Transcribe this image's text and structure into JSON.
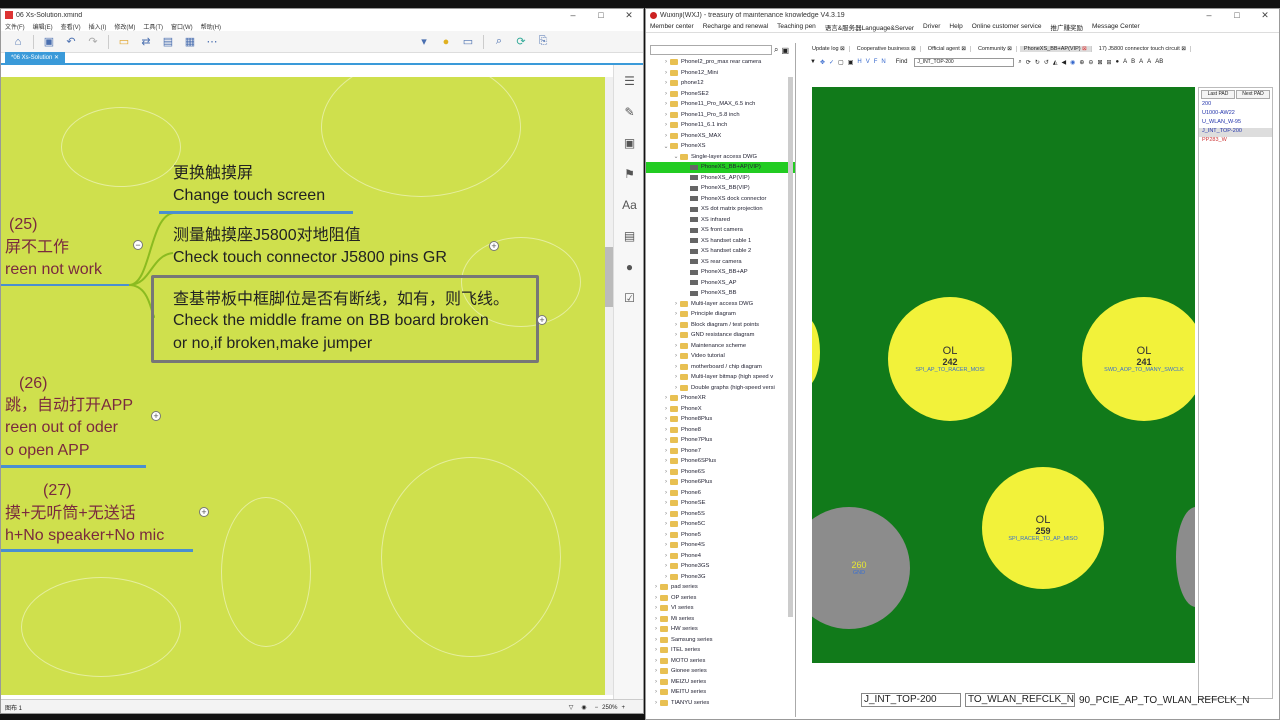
{
  "xmind": {
    "title": "06 Xs-Solution.xmind",
    "menu": [
      "文件(F)",
      "编辑(E)",
      "查看(V)",
      "插入(I)",
      "修改(M)",
      "工具(T)",
      "窗口(W)",
      "帮助(H)"
    ],
    "tab": "*06 Xs-Solution",
    "topics": {
      "t1_cn": "更换触摸屏",
      "t1_en": "Change touch screen",
      "t2_cn": "测量触摸座J5800对地阻值",
      "t2_en": "Check touch connector J5800 pins GR",
      "t3_cn": "查基带板中框脚位是否有断线，如有，则飞线。",
      "t3_en1": "Check the middle frame on BB board broken",
      "t3_en2": "or no,if broken,make jumper",
      "n25": "(25)",
      "n25_cn": "屏不工作",
      "n25_en": "reen not work",
      "n26": "(26)",
      "n26_cn": "跳，自动打开APP",
      "n26_en1": "reen out of oder",
      "n26_en2": "o open APP",
      "n27": "(27)",
      "n27_cn": "摸+无听筒+无送话",
      "n27_en": "h+No speaker+No mic"
    },
    "status_left": "图布 1",
    "zoom": "250%"
  },
  "wx": {
    "title": "Wuxinji(WXJ) - treasury of maintenance knowledge V4.3.19",
    "menu": [
      "Member center",
      "Recharge and renewal",
      "Teaching pen",
      "语言&服务器Language&Server",
      "Driver",
      "Help",
      "Online customer service",
      "推广赚奖励",
      "Message Center"
    ],
    "tree": [
      {
        "l": "PhoneI2_pro_max rear camera",
        "d": 1,
        "t": "f"
      },
      {
        "l": "Phone12_Mini",
        "d": 1,
        "t": "f"
      },
      {
        "l": "phone12",
        "d": 1,
        "t": "f"
      },
      {
        "l": "PhoneSE2",
        "d": 1,
        "t": "f"
      },
      {
        "l": "Phone11_Pro_MAX_6.5 inch",
        "d": 1,
        "t": "f"
      },
      {
        "l": "Phone11_Pro_5.8 inch",
        "d": 1,
        "t": "f"
      },
      {
        "l": "Phone11_6.1 inch",
        "d": 1,
        "t": "f"
      },
      {
        "l": "PhoneXS_MAX",
        "d": 1,
        "t": "f"
      },
      {
        "l": "PhoneXS",
        "d": 1,
        "t": "f",
        "o": 1
      },
      {
        "l": "Single-layer access DWG",
        "d": 2,
        "t": "f",
        "o": 1
      },
      {
        "l": "PhoneXS_BB+AP(VIP)",
        "d": 3,
        "t": "d",
        "s": 1
      },
      {
        "l": "PhoneXS_AP(VIP)",
        "d": 3,
        "t": "d"
      },
      {
        "l": "PhoneXS_BB(VIP)",
        "d": 3,
        "t": "d"
      },
      {
        "l": "PhoneXS dock connector",
        "d": 3,
        "t": "d"
      },
      {
        "l": "XS dot matrix projection",
        "d": 3,
        "t": "d"
      },
      {
        "l": "XS infrared",
        "d": 3,
        "t": "d"
      },
      {
        "l": "XS front camera",
        "d": 3,
        "t": "d"
      },
      {
        "l": "XS handset cable 1",
        "d": 3,
        "t": "d"
      },
      {
        "l": "XS handset cable 2",
        "d": 3,
        "t": "d"
      },
      {
        "l": "XS rear camera",
        "d": 3,
        "t": "d"
      },
      {
        "l": "PhoneXS_BB+AP",
        "d": 3,
        "t": "d"
      },
      {
        "l": "PhoneXS_AP",
        "d": 3,
        "t": "d"
      },
      {
        "l": "PhoneXS_BB",
        "d": 3,
        "t": "d"
      },
      {
        "l": "Multi-layer access DWG",
        "d": 2,
        "t": "f"
      },
      {
        "l": "Principle diagram",
        "d": 2,
        "t": "f"
      },
      {
        "l": "Block diagram / test points",
        "d": 2,
        "t": "f"
      },
      {
        "l": "GND resistance diagram",
        "d": 2,
        "t": "f"
      },
      {
        "l": "Maintenance scheme",
        "d": 2,
        "t": "f"
      },
      {
        "l": "Video tutorial",
        "d": 2,
        "t": "f"
      },
      {
        "l": "motherboard / chip diagram",
        "d": 2,
        "t": "f"
      },
      {
        "l": "Multi-layer bitmap (high speed v",
        "d": 2,
        "t": "f"
      },
      {
        "l": "Double graphs (high-speed versi",
        "d": 2,
        "t": "f"
      },
      {
        "l": "PhoneXR",
        "d": 1,
        "t": "f"
      },
      {
        "l": "PhoneX",
        "d": 1,
        "t": "f"
      },
      {
        "l": "Phone8Plus",
        "d": 1,
        "t": "f"
      },
      {
        "l": "Phone8",
        "d": 1,
        "t": "f"
      },
      {
        "l": "Phone7Plus",
        "d": 1,
        "t": "f"
      },
      {
        "l": "Phone7",
        "d": 1,
        "t": "f"
      },
      {
        "l": "Phone6SPlus",
        "d": 1,
        "t": "f"
      },
      {
        "l": "Phone6S",
        "d": 1,
        "t": "f"
      },
      {
        "l": "Phone6Plus",
        "d": 1,
        "t": "f"
      },
      {
        "l": "Phone6",
        "d": 1,
        "t": "f"
      },
      {
        "l": "PhoneSE",
        "d": 1,
        "t": "f"
      },
      {
        "l": "Phone5S",
        "d": 1,
        "t": "f"
      },
      {
        "l": "Phone5C",
        "d": 1,
        "t": "f"
      },
      {
        "l": "Phone5",
        "d": 1,
        "t": "f"
      },
      {
        "l": "Phone4S",
        "d": 1,
        "t": "f"
      },
      {
        "l": "Phone4",
        "d": 1,
        "t": "f"
      },
      {
        "l": "Phone3GS",
        "d": 1,
        "t": "f"
      },
      {
        "l": "Phone3G",
        "d": 1,
        "t": "f"
      },
      {
        "l": "pad series",
        "d": 0,
        "t": "f"
      },
      {
        "l": "OP series",
        "d": 0,
        "t": "f"
      },
      {
        "l": "VI series",
        "d": 0,
        "t": "f"
      },
      {
        "l": "Mi series",
        "d": 0,
        "t": "f"
      },
      {
        "l": "HW series",
        "d": 0,
        "t": "f"
      },
      {
        "l": "Samsung series",
        "d": 0,
        "t": "f"
      },
      {
        "l": "ITEL series",
        "d": 0,
        "t": "f"
      },
      {
        "l": "MOTO series",
        "d": 0,
        "t": "f"
      },
      {
        "l": "Gionee series",
        "d": 0,
        "t": "f"
      },
      {
        "l": "MEIZU series",
        "d": 0,
        "t": "f"
      },
      {
        "l": "MEITU series",
        "d": 0,
        "t": "f"
      },
      {
        "l": "TIANYU series",
        "d": 0,
        "t": "f"
      }
    ],
    "doc_tabs": [
      "Update log",
      "Cooperative business",
      "Official agent",
      "Community",
      "PhoneXS_BB+AP(VIP)",
      "17) J5800 connector touch circuit"
    ],
    "find_label": "Find",
    "find_value": "J_INT_TOP-200",
    "pads": {
      "p242_ol": "OL",
      "p242_num": "242",
      "p242_net": "SPI_AP_TO_RACER_MOSI",
      "p241_ol": "OL",
      "p241_num": "241",
      "p241_net": "SWD_AOP_TO_MANY_SWCLK",
      "p259_ol": "OL",
      "p259_num": "259",
      "p259_net": "SPI_RACER_TO_AP_MISO",
      "p260_num": "260",
      "p260_net": "GND"
    },
    "nets_btns": [
      "Last PAD",
      "Next PAD"
    ],
    "nets": [
      "200",
      "U1000-AW22",
      "U_WLAN_W-95",
      "J_INT_TOP-200",
      "PP283_W"
    ],
    "bottom": {
      "combo1": "J_INT_TOP-200",
      "combo2": "TO_WLAN_REFCLK_N",
      "text": "90_PCIE_AP_TO_WLAN_REFCLK_N"
    }
  }
}
